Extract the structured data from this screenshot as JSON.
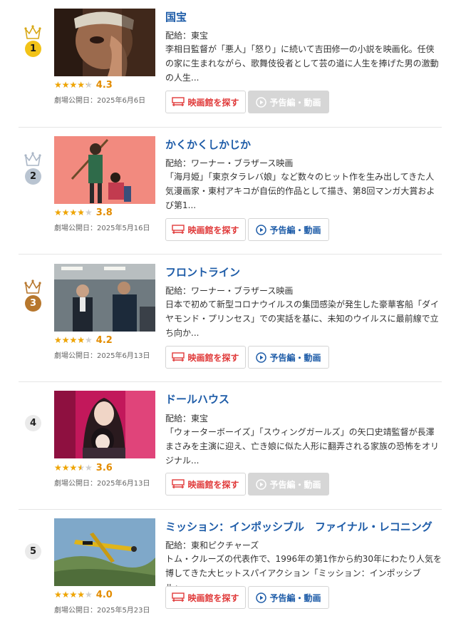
{
  "movies": [
    {
      "rank": "1",
      "title": "国宝",
      "distributor": "配給：東宝",
      "description": "李相日監督が「悪人」「怒り」に続いて吉田修一の小説を映画化。任侠の家に生まれながら、歌舞伎役者として芸の道に人生を捧げた男の激動の人生...",
      "rating_value": 4.3,
      "rating_label": "4.3",
      "release": "劇場公開日：2025年6月6日",
      "theater_label": "映画館を探す",
      "trailer_label": "予告編・動画",
      "trailer_enabled": false,
      "crown": "gold"
    },
    {
      "rank": "2",
      "title": "かくかくしかじか",
      "distributor": "配給：ワーナー・ブラザース映画",
      "description": "「海月姫」「東京タラレバ娘」など数々のヒット作を生み出してきた人気漫画家・東村アキコが自伝的作品として描き、第8回マンガ大賞および第1...",
      "rating_value": 3.8,
      "rating_label": "3.8",
      "release": "劇場公開日：2025年5月16日",
      "theater_label": "映画館を探す",
      "trailer_label": "予告編・動画",
      "trailer_enabled": true,
      "crown": "silver"
    },
    {
      "rank": "3",
      "title": "フロントライン",
      "distributor": "配給：ワーナー・ブラザース映画",
      "description": "日本で初めて新型コロナウイルスの集団感染が発生した豪華客船「ダイヤモンド・プリンセス」での実話を基に、未知のウイルスに最前線で立ち向か...",
      "rating_value": 4.2,
      "rating_label": "4.2",
      "release": "劇場公開日：2025年6月13日",
      "theater_label": "映画館を探す",
      "trailer_label": "予告編・動画",
      "trailer_enabled": true,
      "crown": "bronze"
    },
    {
      "rank": "4",
      "title": "ドールハウス",
      "distributor": "配給：東宝",
      "description": "「ウォーターボーイズ」「スウィングガールズ」の矢口史靖監督が長澤まさみを主演に迎え、亡き娘に似た人形に翻弄される家族の恐怖をオリジナル...",
      "rating_value": 3.6,
      "rating_label": "3.6",
      "release": "劇場公開日：2025年6月13日",
      "theater_label": "映画館を探す",
      "trailer_label": "予告編・動画",
      "trailer_enabled": false,
      "crown": "none"
    },
    {
      "rank": "5",
      "title": "ミッション：インポッシブル　ファイナル・レコニング",
      "distributor": "配給：東和ピクチャーズ",
      "description": "トム・クルーズの代表作で、1996年の第1作から約30年にわたり人気を博してきた大ヒットスパイアクション「ミッション：インポッシブル」...",
      "rating_value": 4.0,
      "rating_label": "4.0",
      "release": "劇場公開日：2025年5月23日",
      "theater_label": "映画館を探す",
      "trailer_label": "予告編・動画",
      "trailer_enabled": true,
      "crown": "none"
    }
  ],
  "colors": {
    "title": "#1e5ca8",
    "theater_button": "#e03a3a",
    "star": "#f0a500",
    "score": "#e38c00",
    "rank_gold": "#f2c318",
    "rank_silver": "#b9c4d1",
    "rank_bronze": "#b7772d"
  },
  "icons": {
    "crown": "crown-icon",
    "theater": "theater-seat-icon",
    "trailer": "play-circle-icon"
  }
}
